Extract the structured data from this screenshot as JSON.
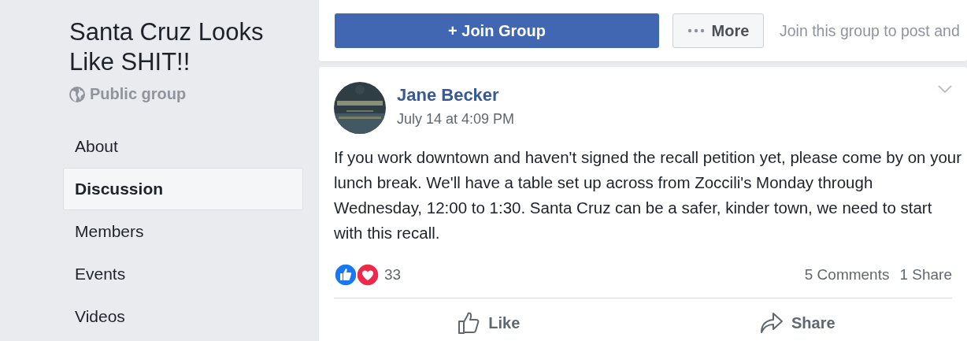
{
  "group": {
    "title": "Santa Cruz Looks Like SHIT!!",
    "privacy": "Public group"
  },
  "nav": [
    {
      "label": "About",
      "selected": false
    },
    {
      "label": "Discussion",
      "selected": true
    },
    {
      "label": "Members",
      "selected": false
    },
    {
      "label": "Events",
      "selected": false
    },
    {
      "label": "Videos",
      "selected": false
    }
  ],
  "join_bar": {
    "join_button": "+ Join Group",
    "more_button": "More",
    "hint": "Join this group to post and"
  },
  "post": {
    "author": "Jane Becker",
    "time": "July 14 at 4:09 PM",
    "text": "If you work downtown and haven't signed the recall petition yet, please come by on your lunch break. We'll have a table set up across from Zoccili's Monday through Wednesday, 12:00 to 1:30. Santa Cruz can be a safer, kinder town, we need to start with this recall.",
    "reaction_count": "33",
    "comments": "5 Comments",
    "shares": "1 Share",
    "actions": [
      {
        "kind": "like",
        "label": "Like"
      },
      {
        "kind": "share",
        "label": "Share"
      }
    ]
  }
}
